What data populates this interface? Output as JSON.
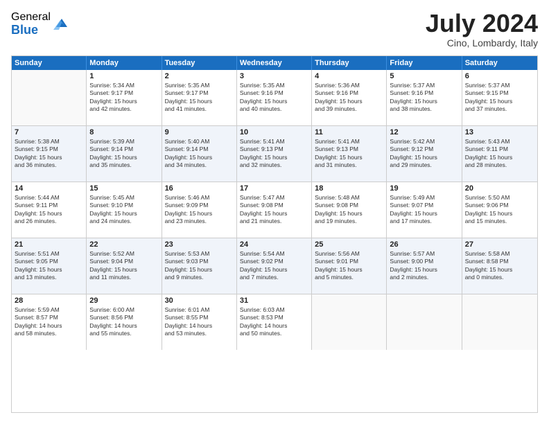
{
  "logo": {
    "general": "General",
    "blue": "Blue"
  },
  "title": "July 2024",
  "location": "Cino, Lombardy, Italy",
  "header_days": [
    "Sunday",
    "Monday",
    "Tuesday",
    "Wednesday",
    "Thursday",
    "Friday",
    "Saturday"
  ],
  "weeks": [
    {
      "style": "row-white",
      "cells": [
        {
          "day": "",
          "lines": []
        },
        {
          "day": "1",
          "lines": [
            "Sunrise: 5:34 AM",
            "Sunset: 9:17 PM",
            "Daylight: 15 hours",
            "and 42 minutes."
          ]
        },
        {
          "day": "2",
          "lines": [
            "Sunrise: 5:35 AM",
            "Sunset: 9:17 PM",
            "Daylight: 15 hours",
            "and 41 minutes."
          ]
        },
        {
          "day": "3",
          "lines": [
            "Sunrise: 5:35 AM",
            "Sunset: 9:16 PM",
            "Daylight: 15 hours",
            "and 40 minutes."
          ]
        },
        {
          "day": "4",
          "lines": [
            "Sunrise: 5:36 AM",
            "Sunset: 9:16 PM",
            "Daylight: 15 hours",
            "and 39 minutes."
          ]
        },
        {
          "day": "5",
          "lines": [
            "Sunrise: 5:37 AM",
            "Sunset: 9:16 PM",
            "Daylight: 15 hours",
            "and 38 minutes."
          ]
        },
        {
          "day": "6",
          "lines": [
            "Sunrise: 5:37 AM",
            "Sunset: 9:15 PM",
            "Daylight: 15 hours",
            "and 37 minutes."
          ]
        }
      ]
    },
    {
      "style": "row-alt",
      "cells": [
        {
          "day": "7",
          "lines": [
            "Sunrise: 5:38 AM",
            "Sunset: 9:15 PM",
            "Daylight: 15 hours",
            "and 36 minutes."
          ]
        },
        {
          "day": "8",
          "lines": [
            "Sunrise: 5:39 AM",
            "Sunset: 9:14 PM",
            "Daylight: 15 hours",
            "and 35 minutes."
          ]
        },
        {
          "day": "9",
          "lines": [
            "Sunrise: 5:40 AM",
            "Sunset: 9:14 PM",
            "Daylight: 15 hours",
            "and 34 minutes."
          ]
        },
        {
          "day": "10",
          "lines": [
            "Sunrise: 5:41 AM",
            "Sunset: 9:13 PM",
            "Daylight: 15 hours",
            "and 32 minutes."
          ]
        },
        {
          "day": "11",
          "lines": [
            "Sunrise: 5:41 AM",
            "Sunset: 9:13 PM",
            "Daylight: 15 hours",
            "and 31 minutes."
          ]
        },
        {
          "day": "12",
          "lines": [
            "Sunrise: 5:42 AM",
            "Sunset: 9:12 PM",
            "Daylight: 15 hours",
            "and 29 minutes."
          ]
        },
        {
          "day": "13",
          "lines": [
            "Sunrise: 5:43 AM",
            "Sunset: 9:11 PM",
            "Daylight: 15 hours",
            "and 28 minutes."
          ]
        }
      ]
    },
    {
      "style": "row-white",
      "cells": [
        {
          "day": "14",
          "lines": [
            "Sunrise: 5:44 AM",
            "Sunset: 9:11 PM",
            "Daylight: 15 hours",
            "and 26 minutes."
          ]
        },
        {
          "day": "15",
          "lines": [
            "Sunrise: 5:45 AM",
            "Sunset: 9:10 PM",
            "Daylight: 15 hours",
            "and 24 minutes."
          ]
        },
        {
          "day": "16",
          "lines": [
            "Sunrise: 5:46 AM",
            "Sunset: 9:09 PM",
            "Daylight: 15 hours",
            "and 23 minutes."
          ]
        },
        {
          "day": "17",
          "lines": [
            "Sunrise: 5:47 AM",
            "Sunset: 9:08 PM",
            "Daylight: 15 hours",
            "and 21 minutes."
          ]
        },
        {
          "day": "18",
          "lines": [
            "Sunrise: 5:48 AM",
            "Sunset: 9:08 PM",
            "Daylight: 15 hours",
            "and 19 minutes."
          ]
        },
        {
          "day": "19",
          "lines": [
            "Sunrise: 5:49 AM",
            "Sunset: 9:07 PM",
            "Daylight: 15 hours",
            "and 17 minutes."
          ]
        },
        {
          "day": "20",
          "lines": [
            "Sunrise: 5:50 AM",
            "Sunset: 9:06 PM",
            "Daylight: 15 hours",
            "and 15 minutes."
          ]
        }
      ]
    },
    {
      "style": "row-alt",
      "cells": [
        {
          "day": "21",
          "lines": [
            "Sunrise: 5:51 AM",
            "Sunset: 9:05 PM",
            "Daylight: 15 hours",
            "and 13 minutes."
          ]
        },
        {
          "day": "22",
          "lines": [
            "Sunrise: 5:52 AM",
            "Sunset: 9:04 PM",
            "Daylight: 15 hours",
            "and 11 minutes."
          ]
        },
        {
          "day": "23",
          "lines": [
            "Sunrise: 5:53 AM",
            "Sunset: 9:03 PM",
            "Daylight: 15 hours",
            "and 9 minutes."
          ]
        },
        {
          "day": "24",
          "lines": [
            "Sunrise: 5:54 AM",
            "Sunset: 9:02 PM",
            "Daylight: 15 hours",
            "and 7 minutes."
          ]
        },
        {
          "day": "25",
          "lines": [
            "Sunrise: 5:56 AM",
            "Sunset: 9:01 PM",
            "Daylight: 15 hours",
            "and 5 minutes."
          ]
        },
        {
          "day": "26",
          "lines": [
            "Sunrise: 5:57 AM",
            "Sunset: 9:00 PM",
            "Daylight: 15 hours",
            "and 2 minutes."
          ]
        },
        {
          "day": "27",
          "lines": [
            "Sunrise: 5:58 AM",
            "Sunset: 8:58 PM",
            "Daylight: 15 hours",
            "and 0 minutes."
          ]
        }
      ]
    },
    {
      "style": "row-white",
      "cells": [
        {
          "day": "28",
          "lines": [
            "Sunrise: 5:59 AM",
            "Sunset: 8:57 PM",
            "Daylight: 14 hours",
            "and 58 minutes."
          ]
        },
        {
          "day": "29",
          "lines": [
            "Sunrise: 6:00 AM",
            "Sunset: 8:56 PM",
            "Daylight: 14 hours",
            "and 55 minutes."
          ]
        },
        {
          "day": "30",
          "lines": [
            "Sunrise: 6:01 AM",
            "Sunset: 8:55 PM",
            "Daylight: 14 hours",
            "and 53 minutes."
          ]
        },
        {
          "day": "31",
          "lines": [
            "Sunrise: 6:03 AM",
            "Sunset: 8:53 PM",
            "Daylight: 14 hours",
            "and 50 minutes."
          ]
        },
        {
          "day": "",
          "lines": []
        },
        {
          "day": "",
          "lines": []
        },
        {
          "day": "",
          "lines": []
        }
      ]
    }
  ]
}
